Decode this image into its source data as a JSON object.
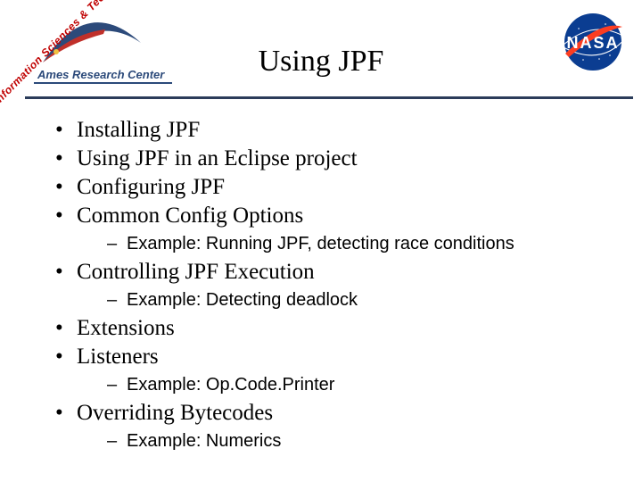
{
  "header": {
    "rotated_text": "Information Sciences & Technology",
    "ames_label": "Ames Research Center",
    "title": "Using JPF",
    "nasa_label": "NASA"
  },
  "bullets": [
    {
      "text": "Installing JPF",
      "sub": []
    },
    {
      "text": "Using JPF in an Eclipse project",
      "sub": []
    },
    {
      "text": "Configuring JPF",
      "sub": []
    },
    {
      "text": "Common Config Options",
      "sub": [
        "Example: Running JPF, detecting race conditions"
      ]
    },
    {
      "text": "Controlling JPF Execution",
      "sub": [
        "Example: Detecting deadlock"
      ]
    },
    {
      "text": "Extensions",
      "sub": []
    },
    {
      "text": "Listeners",
      "sub": [
        "Example: Op.Code.Printer"
      ]
    },
    {
      "text": "Overriding Bytecodes",
      "sub": [
        "Example: Numerics"
      ]
    }
  ]
}
